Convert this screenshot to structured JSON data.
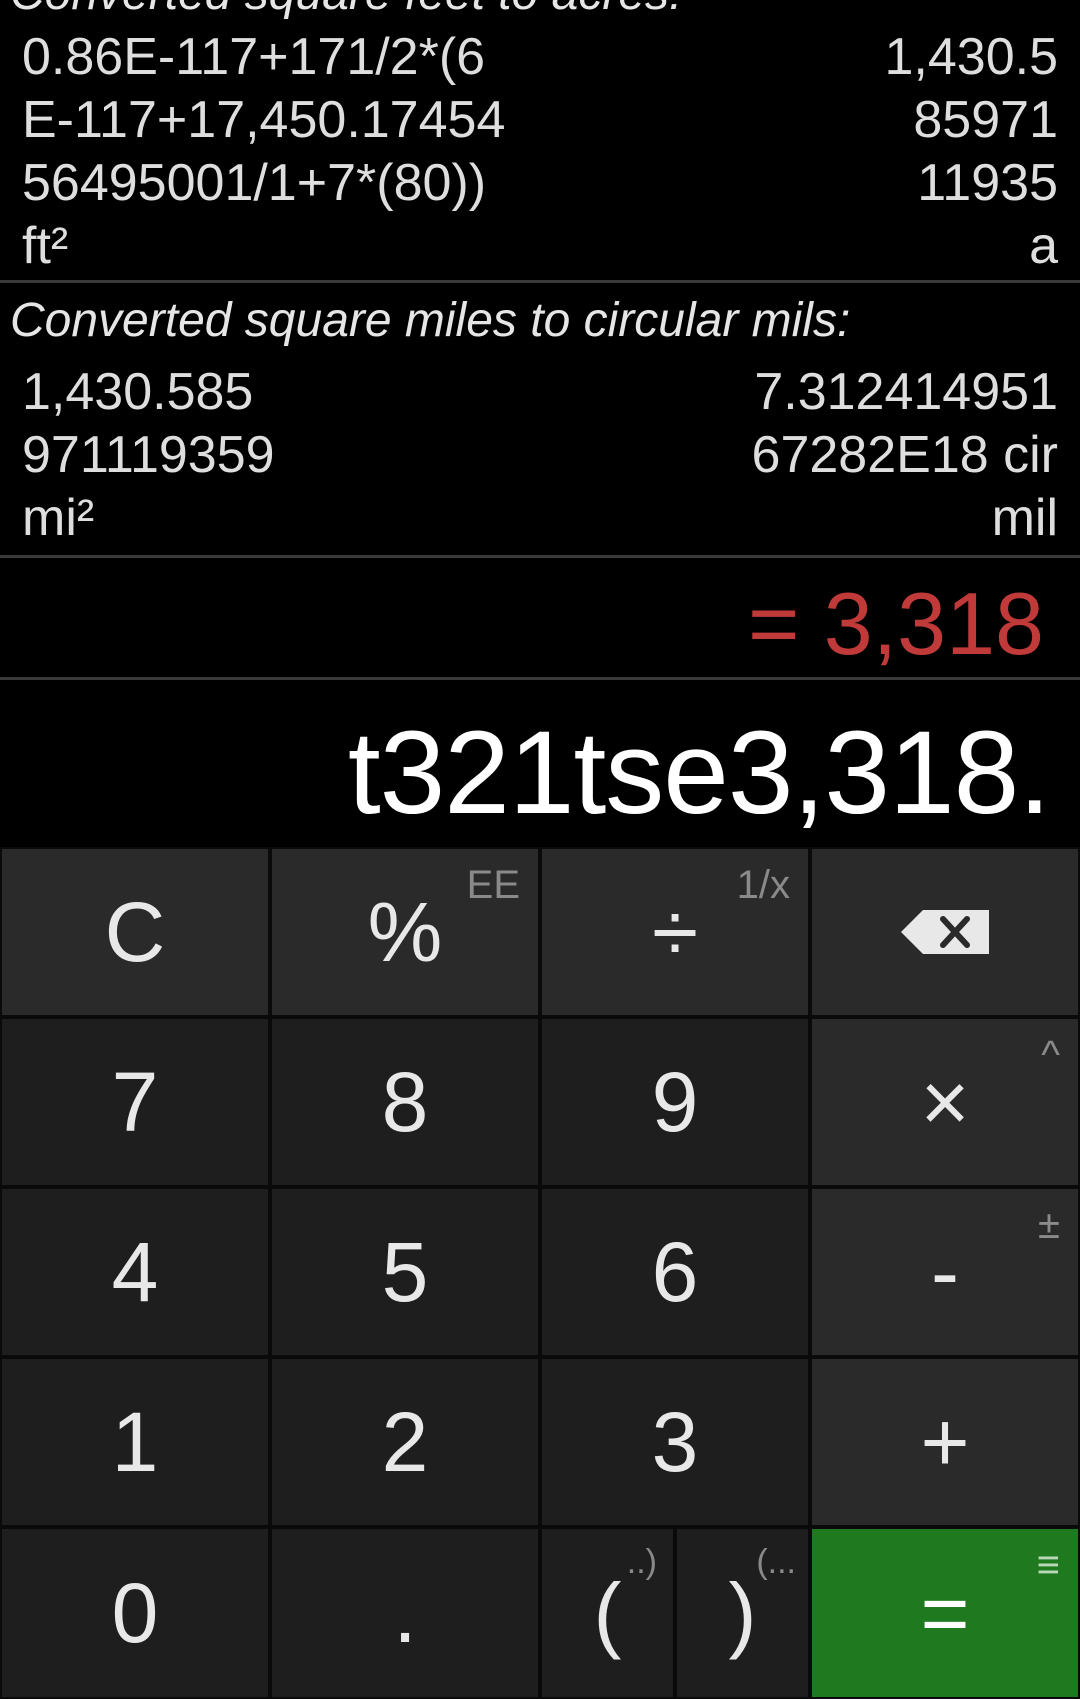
{
  "history": [
    {
      "title": "Converted square feet to acres:",
      "rows": [
        {
          "left": "0.86E-117+171/2*(6",
          "right": "1,430.5"
        },
        {
          "left": "E-117+17,450.17454",
          "right": "85971"
        },
        {
          "left": "56495001/1+7*(80))",
          "right": "11935"
        },
        {
          "left": "ft²",
          "right": "a"
        }
      ]
    },
    {
      "title": "Converted square miles to circular mils:",
      "rows": [
        {
          "left": "1,430.585",
          "right": "7.312414951"
        },
        {
          "left": "971119359",
          "right": "67282E18 cir"
        },
        {
          "left": "mi²",
          "right": "mil"
        }
      ]
    }
  ],
  "result": "= 3,318",
  "expression": "t321tse3,318.",
  "keys": {
    "clear": "C",
    "percent": "%",
    "percent_sub": "EE",
    "divide": "÷",
    "divide_sub": "1/x",
    "seven": "7",
    "eight": "8",
    "nine": "9",
    "multiply": "×",
    "multiply_sub": "^",
    "four": "4",
    "five": "5",
    "six": "6",
    "minus": "-",
    "minus_sub": "±",
    "one": "1",
    "two": "2",
    "three": "3",
    "plus": "+",
    "zero": "0",
    "dot": ".",
    "open_paren": "(",
    "open_paren_sub": "..)",
    "close_paren": ")",
    "close_paren_sub": "(...",
    "equals": "=",
    "equals_sub": "≡"
  },
  "colors": {
    "result": "#c03a3a",
    "equals_key": "#1f7a1f"
  }
}
